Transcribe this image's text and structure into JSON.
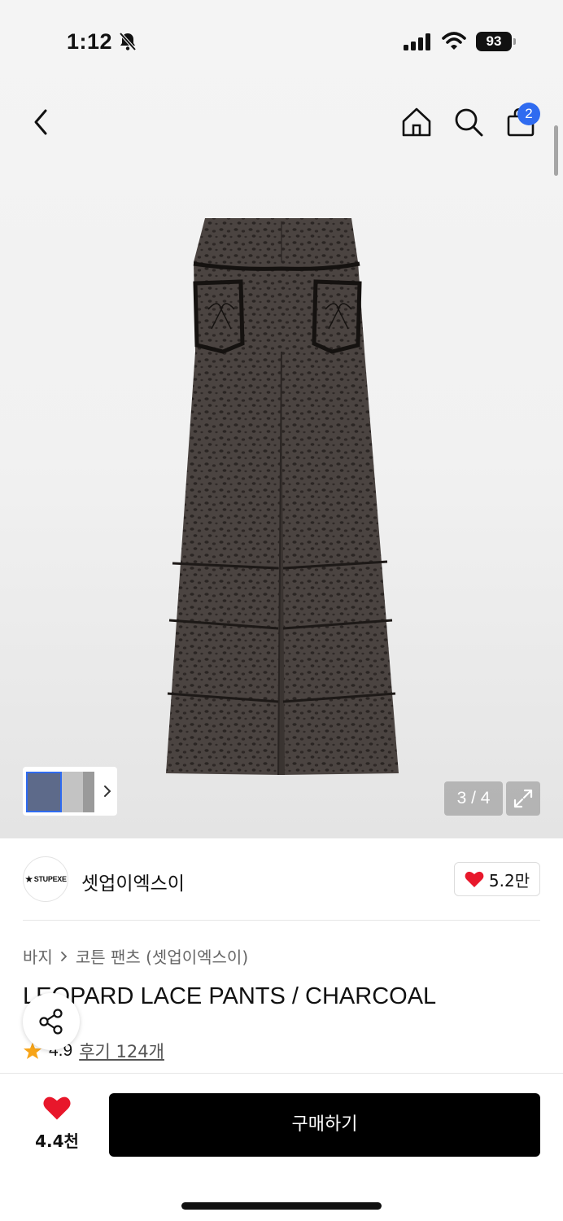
{
  "status_bar": {
    "time": "1:12",
    "battery": "93"
  },
  "header": {
    "cart_count": "2"
  },
  "gallery": {
    "page_counter": "3 / 4"
  },
  "brand": {
    "logo_text": "STUPEXE",
    "name": "셋업이엑스이",
    "likes": "5.2만"
  },
  "breadcrumb": {
    "category": "바지",
    "subcategory": "코튼 팬츠 (셋업이엑스이)"
  },
  "product": {
    "title": "LEOPARD LACE PANTS / CHARCOAL",
    "rating": "4.9",
    "reviews": "후기 124개"
  },
  "bottom_bar": {
    "wish_count": "4.4천",
    "buy_label": "구매하기"
  },
  "colors": {
    "accent_blue": "#2f6bf0",
    "heart_red": "#e8172b",
    "star_orange": "#f7a418",
    "buy_bg": "#000000"
  },
  "icons": [
    "bell-slash-icon",
    "signal-icon",
    "wifi-icon",
    "battery-icon",
    "back-chevron-icon",
    "home-icon",
    "search-icon",
    "shopping-bag-icon",
    "chevron-right-icon",
    "expand-icon",
    "heart-icon",
    "star-icon",
    "share-icon"
  ]
}
